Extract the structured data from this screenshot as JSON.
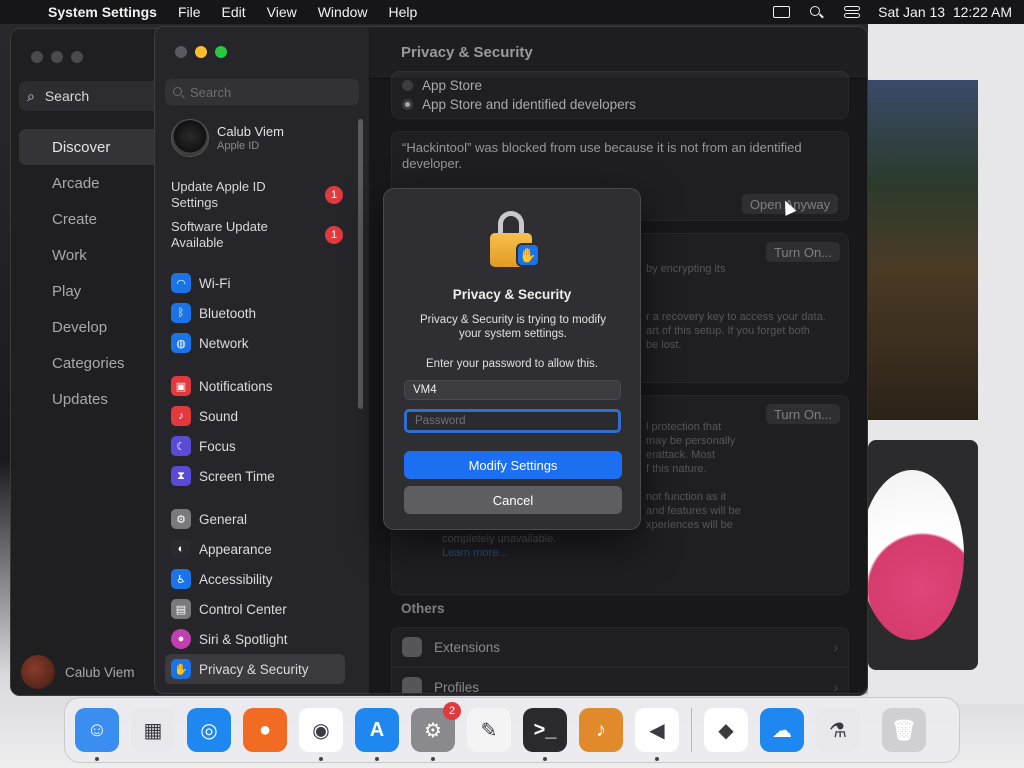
{
  "menubar": {
    "app_name": "System Settings",
    "menus": [
      "File",
      "Edit",
      "View",
      "Window",
      "Help"
    ],
    "datetime": "Sat Jan 13  12:22 AM"
  },
  "appstore": {
    "search_label": "Search",
    "nav": [
      "Discover",
      "Arcade",
      "Create",
      "Work",
      "Play",
      "Develop",
      "Categories",
      "Updates"
    ],
    "active_nav": "Discover",
    "user_name": "Calub Viem"
  },
  "settings": {
    "search_placeholder": "Search",
    "user": {
      "name": "Calub Viem",
      "subtitle": "Apple ID"
    },
    "alerts": [
      {
        "label": "Update Apple ID Settings",
        "count": "1"
      },
      {
        "label": "Software Update Available",
        "count": "1"
      }
    ],
    "groups": [
      [
        {
          "label": "Wi-Fi",
          "icon": "wifi-icon",
          "color": "#1a74e8"
        },
        {
          "label": "Bluetooth",
          "icon": "bluetooth-icon",
          "color": "#1a74e8"
        },
        {
          "label": "Network",
          "icon": "network-icon",
          "color": "#1a74e8"
        }
      ],
      [
        {
          "label": "Notifications",
          "icon": "notifications-icon",
          "color": "#e0393e"
        },
        {
          "label": "Sound",
          "icon": "sound-icon",
          "color": "#e0393e"
        },
        {
          "label": "Focus",
          "icon": "focus-icon",
          "color": "#5a4bd6"
        },
        {
          "label": "Screen Time",
          "icon": "screen-time-icon",
          "color": "#5a4bd6"
        }
      ],
      [
        {
          "label": "General",
          "icon": "general-icon",
          "color": "#7a7a7e"
        },
        {
          "label": "Appearance",
          "icon": "appearance-icon",
          "color": "#2a2a2e"
        },
        {
          "label": "Accessibility",
          "icon": "accessibility-icon",
          "color": "#1a74e8"
        },
        {
          "label": "Control Center",
          "icon": "control-center-icon",
          "color": "#7a7a7e"
        },
        {
          "label": "Siri & Spotlight",
          "icon": "siri-icon",
          "color": "#c13fb0"
        },
        {
          "label": "Privacy & Security",
          "icon": "privacy-hand-icon",
          "color": "#1a74e8"
        }
      ]
    ],
    "active_item": "Privacy & Security",
    "main": {
      "title": "Privacy & Security",
      "radio_app_store": "App Store",
      "radio_identified": "App Store and identified developers",
      "blocked_message": "“Hackintool” was blocked from use because it is not from an identified developer.",
      "open_anyway": "Open Anyway",
      "turn_on_1": "Turn On...",
      "turn_on_2": "Turn On...",
      "filevault_text_a": "by encrypting its",
      "filevault_text_b": "r a recovery key to access your data.",
      "filevault_text_c": "art of this setup. If you forget both",
      "filevault_text_d": "be lost.",
      "lockdown_text_a": "l protection that",
      "lockdown_text_b": "may be personally",
      "lockdown_text_c": "erattack. Most",
      "lockdown_text_d": "f this nature.",
      "lockdown_text_e": "not function as it",
      "lockdown_text_f": "and features will be",
      "lockdown_text_g": "xperiences will be",
      "lockdown_text_h": "completely unavailable.",
      "learn_more": "Learn more...",
      "others_title": "Others",
      "extensions": "Extensions",
      "profiles": "Profiles"
    }
  },
  "dialog": {
    "title": "Privacy & Security",
    "message": "Privacy & Security is trying to modify your system settings.",
    "prompt": "Enter your password to allow this.",
    "username": "VM4",
    "password_placeholder": "Password",
    "primary_button": "Modify Settings",
    "cancel_button": "Cancel"
  },
  "dock": {
    "apps": [
      {
        "name": "finder-icon",
        "color": "#3a8ef0",
        "glyph": "☺",
        "badge": ""
      },
      {
        "name": "launchpad-icon",
        "color": "#e8e8ec",
        "glyph": "▦",
        "badge": ""
      },
      {
        "name": "safari-icon",
        "color": "#1e88f0",
        "glyph": "◎",
        "badge": ""
      },
      {
        "name": "firefox-icon",
        "color": "#f26b22",
        "glyph": "●",
        "badge": ""
      },
      {
        "name": "chrome-icon",
        "color": "#ffffff",
        "glyph": "◉",
        "badge": ""
      },
      {
        "name": "app-store-icon",
        "color": "#1e88f0",
        "glyph": "A",
        "badge": ""
      },
      {
        "name": "system-settings-icon",
        "color": "#8a8a8e",
        "glyph": "⚙",
        "badge": "2"
      },
      {
        "name": "textedit-icon",
        "color": "#f4f4f4",
        "glyph": "✎",
        "badge": ""
      },
      {
        "name": "terminal-icon",
        "color": "#2a2a2e",
        "glyph": ">_",
        "badge": ""
      },
      {
        "name": "garageband-icon",
        "color": "#e08a2b",
        "glyph": "♪",
        "badge": ""
      },
      {
        "name": "vscode-icon",
        "color": "#ffffff",
        "glyph": "◀",
        "badge": ""
      }
    ],
    "apps_right": [
      {
        "name": "visual-studio-icon",
        "color": "#ffffff",
        "glyph": "◆",
        "badge": ""
      },
      {
        "name": "cloud-app-icon",
        "color": "#1e88f0",
        "glyph": "☁",
        "badge": ""
      },
      {
        "name": "flask-app-icon",
        "color": "#e8e8ec",
        "glyph": "⚗",
        "badge": ""
      }
    ],
    "trash": {
      "name": "trash-icon",
      "color": "#d0d0d4",
      "glyph": "🗑"
    }
  }
}
